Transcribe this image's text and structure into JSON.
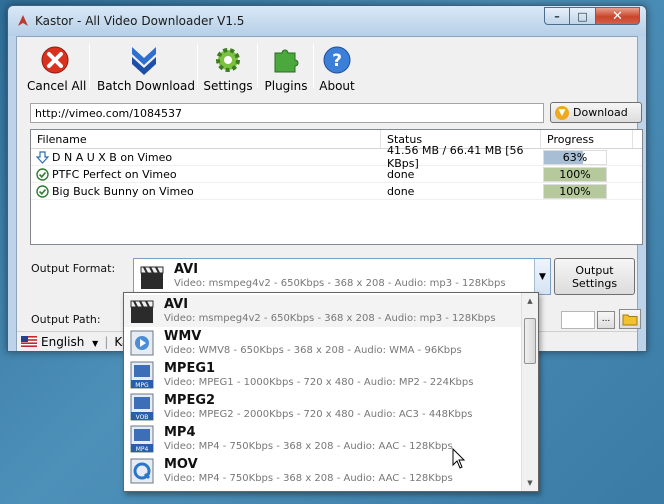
{
  "window": {
    "title": "Kastor - All Video Downloader V1.5"
  },
  "toolbar": {
    "cancel_all": "Cancel All",
    "batch_download": "Batch Download",
    "settings": "Settings",
    "plugins": "Plugins",
    "about": "About"
  },
  "url": {
    "value": "http://vimeo.com/1084537"
  },
  "download_button": "Download",
  "list": {
    "headers": {
      "filename": "Filename",
      "status": "Status",
      "progress": "Progress"
    },
    "rows": [
      {
        "filename": "D N A U X B on Vimeo",
        "status": "41.56 MB / 66.41 MB [56 KBps]",
        "progress": "63%",
        "progress_value": 0.63,
        "icon": "download-arrow-icon",
        "color": "#a7bed4"
      },
      {
        "filename": "PTFC Perfect on Vimeo",
        "status": "done",
        "progress": "100%",
        "progress_value": 1.0,
        "icon": "check-circle-icon",
        "color": "#b6c99c"
      },
      {
        "filename": "Big Buck Bunny on Vimeo",
        "status": "done",
        "progress": "100%",
        "progress_value": 1.0,
        "icon": "check-circle-icon",
        "color": "#b6c99c"
      }
    ]
  },
  "output_format": {
    "label": "Output Format:",
    "selected_name": "AVI",
    "selected_desc": "Video: msmpeg4v2 - 650Kbps - 368 x 208 - Audio: mp3 - 128Kbps"
  },
  "output_settings": "Output Settings",
  "output_path": {
    "label": "Output Path:",
    "browse": "..."
  },
  "statusbar": {
    "language": "English",
    "rest": "Kast"
  },
  "dropdown": {
    "items": [
      {
        "name": "AVI",
        "desc": "Video: msmpeg4v2 - 650Kbps - 368 x 208 - Audio: mp3 - 128Kbps",
        "icon": "clapperboard-icon"
      },
      {
        "name": "WMV",
        "desc": "Video: WMV8 - 650Kbps - 368 x 208 - Audio: WMA - 96Kbps",
        "icon": "media-player-icon"
      },
      {
        "name": "MPEG1",
        "desc": "Video: MPEG1 - 1000Kbps - 720 x 480 - Audio: MP2 - 224Kbps",
        "icon": "mpg-file-icon",
        "badge": "MPG"
      },
      {
        "name": "MPEG2",
        "desc": "Video: MPEG2 - 2000Kbps - 720 x 480 - Audio: AC3 - 448Kbps",
        "icon": "dvd-vob-icon",
        "badge": "VOB"
      },
      {
        "name": "MP4",
        "desc": "Video: MP4 - 750Kbps - 368 x 208 - Audio: AAC - 128Kbps",
        "icon": "mp4-file-icon",
        "badge": "MP4"
      },
      {
        "name": "MOV",
        "desc": "Video: MP4 - 750Kbps - 368 x 208 - Audio: AAC - 128Kbps",
        "icon": "quicktime-icon"
      }
    ]
  }
}
